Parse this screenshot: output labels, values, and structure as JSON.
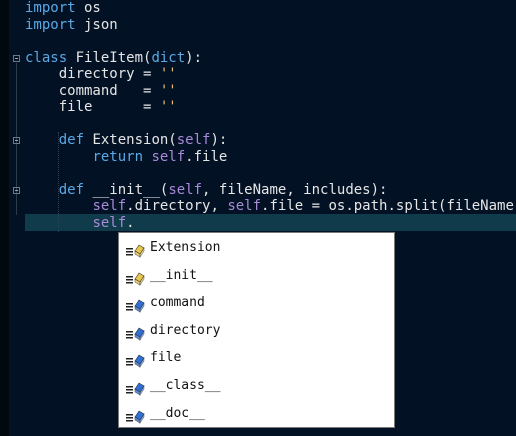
{
  "editor": {
    "lines": [
      [
        {
          "t": "import",
          "c": "kw"
        },
        {
          "t": " os",
          "c": "plain"
        }
      ],
      [
        {
          "t": "import",
          "c": "kw"
        },
        {
          "t": " json",
          "c": "plain"
        }
      ],
      [],
      [
        {
          "t": "class",
          "c": "kw"
        },
        {
          "t": " FileItem(",
          "c": "plain"
        },
        {
          "t": "dict",
          "c": "builtin"
        },
        {
          "t": "):",
          "c": "plain"
        }
      ],
      [
        {
          "t": "    directory = ",
          "c": "plain"
        },
        {
          "t": "''",
          "c": "str"
        }
      ],
      [
        {
          "t": "    command   = ",
          "c": "plain"
        },
        {
          "t": "''",
          "c": "str"
        }
      ],
      [
        {
          "t": "    file      = ",
          "c": "plain"
        },
        {
          "t": "''",
          "c": "str"
        }
      ],
      [],
      [
        {
          "t": "    ",
          "c": "plain"
        },
        {
          "t": "def",
          "c": "kw"
        },
        {
          "t": " Extension(",
          "c": "plain"
        },
        {
          "t": "self",
          "c": "self"
        },
        {
          "t": "):",
          "c": "plain"
        }
      ],
      [
        {
          "t": "        ",
          "c": "plain"
        },
        {
          "t": "return",
          "c": "kw"
        },
        {
          "t": " ",
          "c": "plain"
        },
        {
          "t": "self",
          "c": "self"
        },
        {
          "t": ".file",
          "c": "plain"
        }
      ],
      [],
      [
        {
          "t": "    ",
          "c": "plain"
        },
        {
          "t": "def",
          "c": "kw"
        },
        {
          "t": " __init__(",
          "c": "plain"
        },
        {
          "t": "self",
          "c": "self"
        },
        {
          "t": ", fileName, includes):",
          "c": "plain"
        }
      ],
      [
        {
          "t": "        ",
          "c": "plain"
        },
        {
          "t": "self",
          "c": "self"
        },
        {
          "t": ".directory, ",
          "c": "plain"
        },
        {
          "t": "self",
          "c": "self"
        },
        {
          "t": ".file = os.path.split(fileName)",
          "c": "plain"
        }
      ],
      [
        {
          "t": "        ",
          "c": "plain"
        },
        {
          "t": "self",
          "c": "self"
        },
        {
          "t": ".",
          "c": "plain"
        }
      ]
    ]
  },
  "autocomplete": {
    "items": [
      {
        "label": "Extension",
        "kind": "method",
        "icon": "method-icon"
      },
      {
        "label": "__init__",
        "kind": "method",
        "icon": "method-icon"
      },
      {
        "label": "command",
        "kind": "field",
        "icon": "field-icon"
      },
      {
        "label": "directory",
        "kind": "field",
        "icon": "field-icon"
      },
      {
        "label": "file",
        "kind": "field",
        "icon": "field-icon"
      },
      {
        "label": "__class__",
        "kind": "field",
        "icon": "field-icon"
      },
      {
        "label": "__doc__",
        "kind": "field",
        "icon": "field-icon"
      }
    ]
  },
  "colors": {
    "background": "#021124",
    "current_line": "#0f3b4a",
    "keyword": "#5aa9e6",
    "string": "#e6c07b",
    "self": "#a98bd8",
    "method_icon": "#e8c84a",
    "field_icon": "#2f6fd6"
  }
}
